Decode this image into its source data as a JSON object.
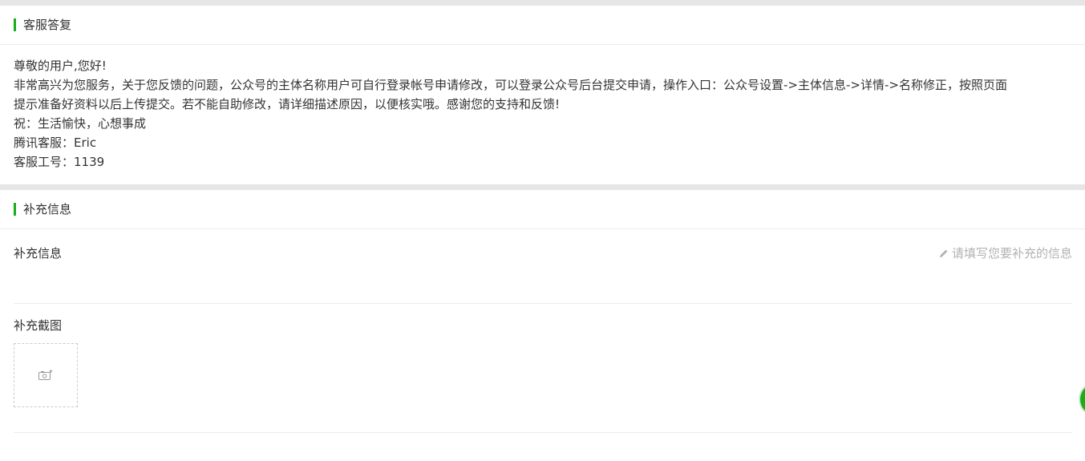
{
  "reply_section": {
    "title": "客服答复",
    "greeting": "尊敬的用户,您好!",
    "body_line1": "非常高兴为您服务，关于您反馈的问题，公众号的主体名称用户可自行登录帐号申请修改，可以登录公众号后台提交申请，操作入口：公众号设置->主体信息->详情->名称修正，按照页面",
    "body_line2": "提示准备好资料以后上传提交。若不能自助修改，请详细描述原因，以便核实哦。感谢您的支持和反馈!",
    "wish": "祝：生活愉快，心想事成",
    "agent": "腾讯客服：Eric",
    "agent_id": "客服工号：1139"
  },
  "supplement_section": {
    "title": "补充信息",
    "info_label": "补充信息",
    "info_placeholder": "请填写您要补充的信息",
    "screenshot_label": "补充截图"
  },
  "icons": {
    "edit": "pencil-icon",
    "add_photo": "camera-plus-icon"
  },
  "colors": {
    "accent": "#1aad19",
    "placeholder": "#b2b2b2",
    "separator": "#e6e6e6"
  }
}
